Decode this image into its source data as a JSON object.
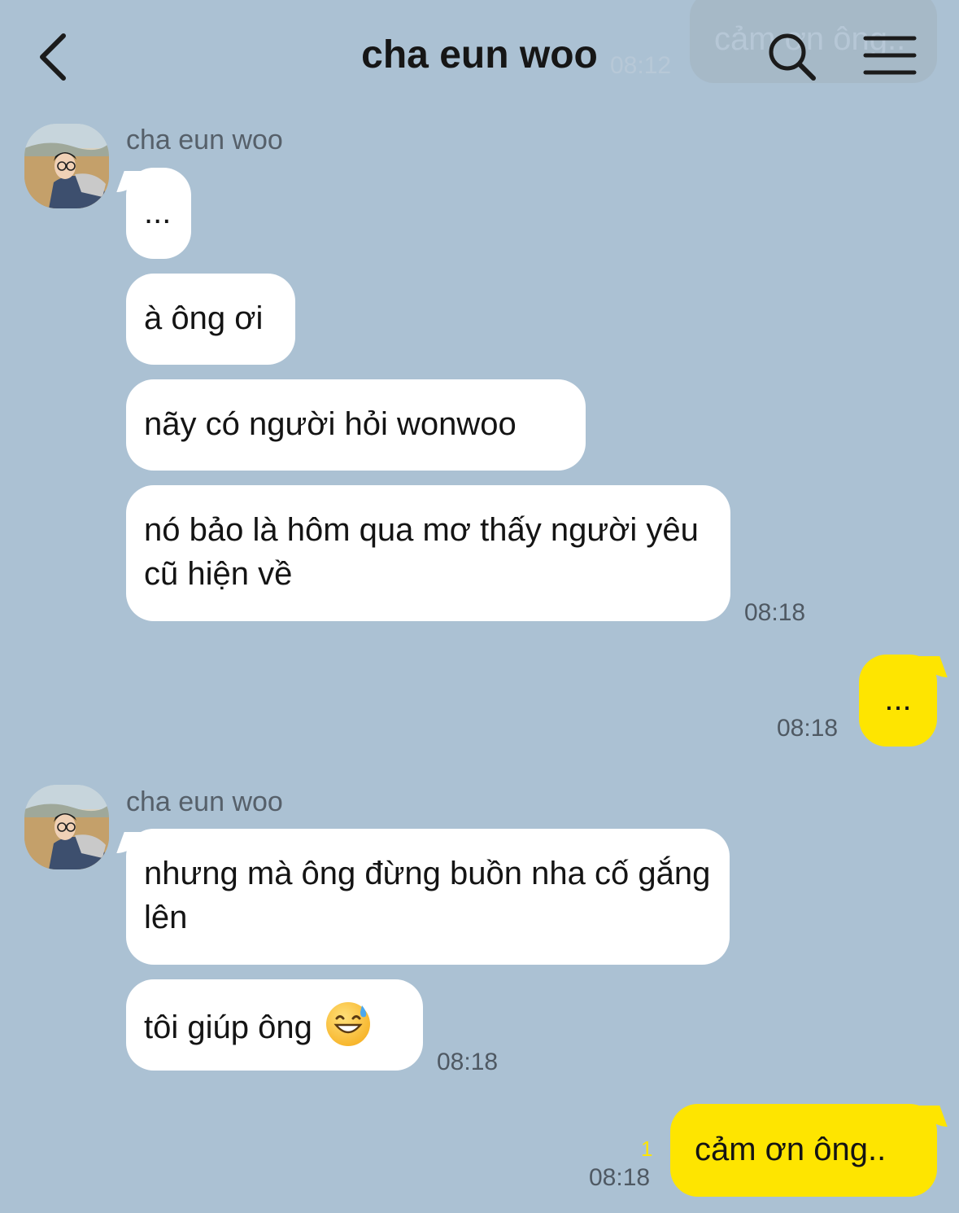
{
  "header": {
    "title": "cha eun woo",
    "ghost_preview_text": "cảm ơn ông..",
    "ghost_preview_time": "08:12"
  },
  "icons": {
    "back": "chevron-left-icon",
    "search": "search-icon",
    "menu": "hamburger-menu-icon"
  },
  "colors": {
    "background": "#abc1d3",
    "incoming_bubble": "#ffffff",
    "outgoing_bubble": "#fee500",
    "unread_count": "#fee500"
  },
  "messages": {
    "group1": {
      "sender": "cha eun woo",
      "m1": "...",
      "m2": "à ông ơi",
      "m3": "nãy có người hỏi wonwoo",
      "m4": "nó bảo là hôm qua mơ thấy người yêu cũ hiện về",
      "time": "08:18"
    },
    "mine1": {
      "text": "...",
      "time": "08:18"
    },
    "group2": {
      "sender": "cha eun woo",
      "m1": "nhưng mà ông đừng buồn nha cố gắng lên",
      "m2": "tôi giúp ông",
      "m2_emoji": "grinning-face-with-sweat-emoji",
      "time": "08:18"
    },
    "mine2": {
      "text": "cảm ơn ông..",
      "time": "08:18",
      "unread": "1"
    }
  }
}
